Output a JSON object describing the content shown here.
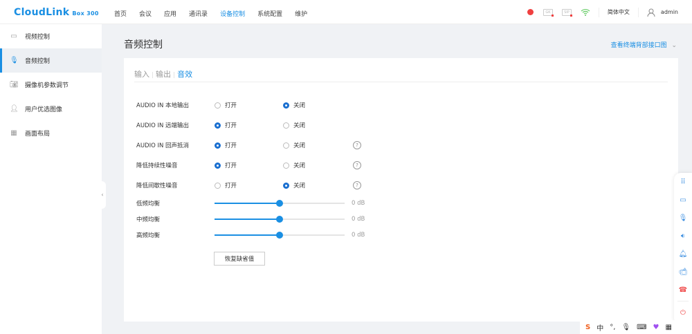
{
  "header": {
    "logo": "CloudLink",
    "model": "Box 300",
    "nav": [
      "首页",
      "会议",
      "应用",
      "通讯录",
      "设备控制",
      "系统配置",
      "维护"
    ],
    "active_nav": "设备控制",
    "status_icons": [
      "record-dot-icon",
      "gk-icon",
      "sip-icon",
      "wifi-icon"
    ],
    "gk_label": "GK",
    "sip_label": "SIP",
    "language": "简体中文",
    "user": "admin"
  },
  "sidebar": {
    "items": [
      {
        "label": "视频控制",
        "icon": "video-icon"
      },
      {
        "label": "音频控制",
        "icon": "microphone-icon",
        "active": true
      },
      {
        "label": "摄像机参数调节",
        "icon": "camera-icon"
      },
      {
        "label": "用户优选图像",
        "icon": "user-icon"
      },
      {
        "label": "画面布局",
        "icon": "layout-grid-icon"
      }
    ]
  },
  "page": {
    "title": "音频控制",
    "back_link": "查看终端背部接口图",
    "tabs": [
      "输入",
      "输出",
      "音效"
    ],
    "active_tab": "音效",
    "on_label": "打开",
    "off_label": "关闭",
    "options": [
      {
        "label": "AUDIO IN 本地输出",
        "value": "关闭",
        "help": false
      },
      {
        "label": "AUDIO IN 远端输出",
        "value": "打开",
        "help": false
      },
      {
        "label": "AUDIO IN 回声抵消",
        "value": "打开",
        "help": true
      },
      {
        "label": "降低持续性噪音",
        "value": "打开",
        "help": true
      },
      {
        "label": "降低间歇性噪音",
        "value": "关闭",
        "help": true
      }
    ],
    "equalizers": [
      {
        "label": "低频均衡",
        "value": "0 dB",
        "level_percent": 50
      },
      {
        "label": "中频均衡",
        "value": "0 dB",
        "level_percent": 50
      },
      {
        "label": "高频均衡",
        "value": "0 dB",
        "level_percent": 50
      }
    ],
    "reset_button": "恢复缺省值"
  },
  "colors": {
    "accent": "#1a8fe3",
    "radio": "#1a6fd0",
    "danger": "#f04040"
  },
  "ime": {
    "mode": "中"
  }
}
